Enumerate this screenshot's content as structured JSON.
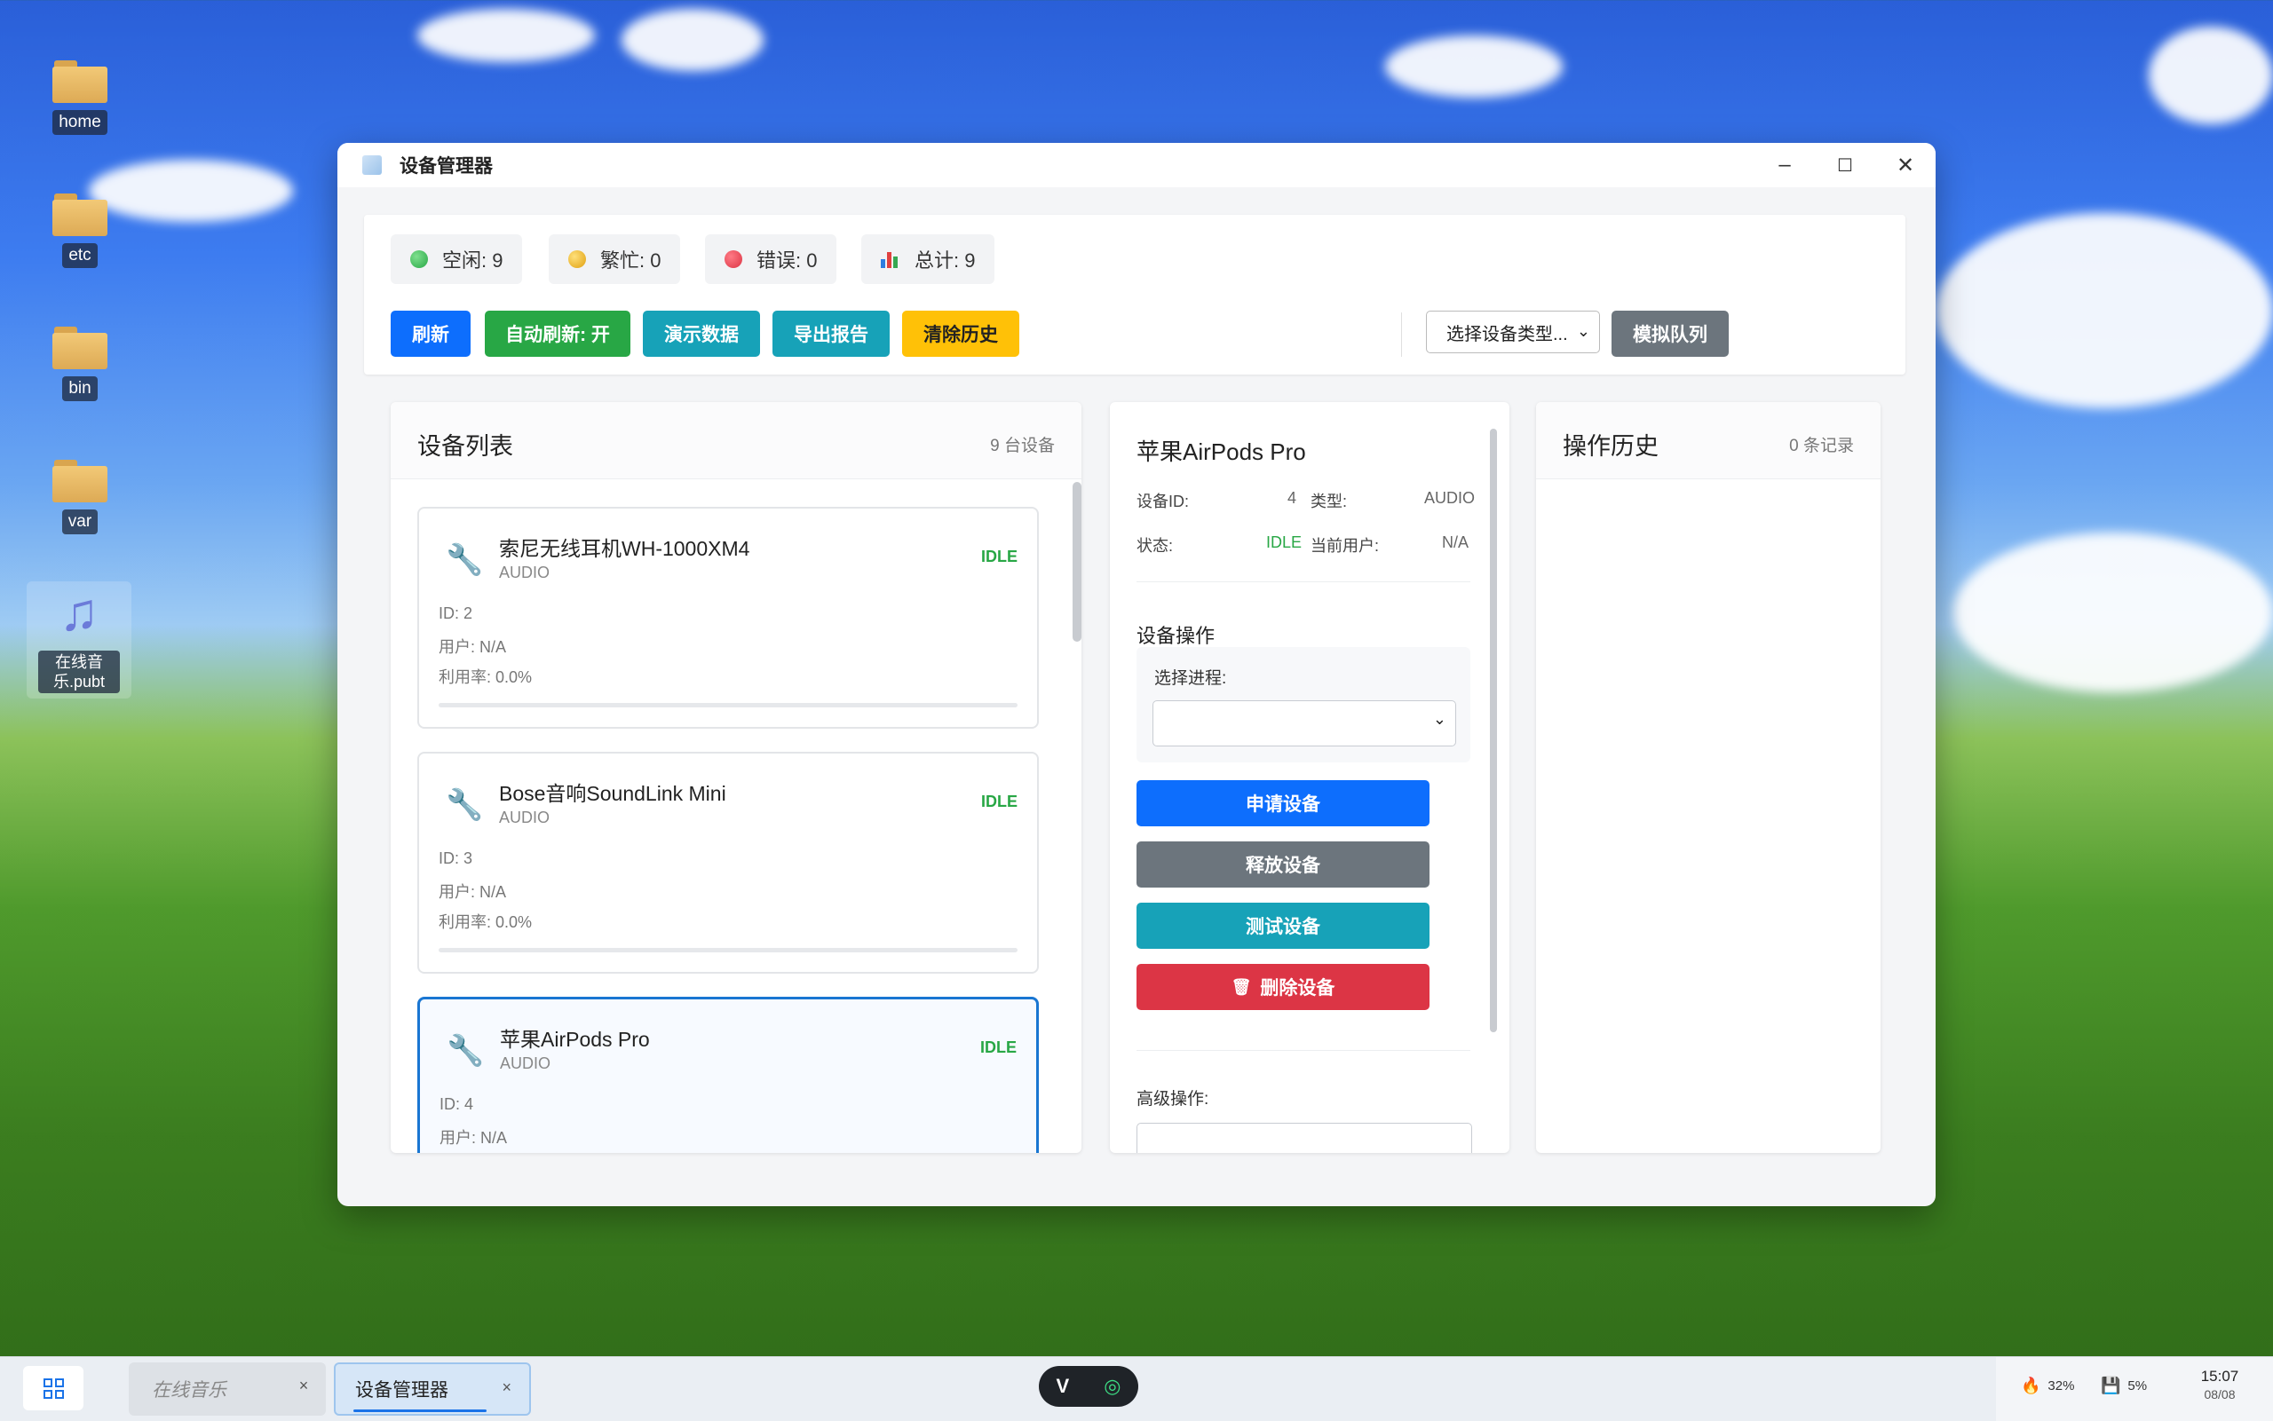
{
  "desktop": {
    "icons": [
      {
        "label": "home",
        "type": "folder"
      },
      {
        "label": "etc",
        "type": "folder"
      },
      {
        "label": "bin",
        "type": "folder"
      },
      {
        "label": "var",
        "type": "folder"
      },
      {
        "label": "在线音乐.pubt",
        "type": "music-file-icon"
      }
    ]
  },
  "window": {
    "title": "设备管理器",
    "controls": {
      "minimize": "–",
      "maximize": "☐",
      "close": "✕"
    }
  },
  "stats": {
    "idle": "空闲: 9",
    "busy": "繁忙: 0",
    "error": "错误: 0",
    "total": "总计: 9"
  },
  "colors": {
    "idle_dot": "#28a745",
    "busy_dot": "#f0b020",
    "error_dot": "#dc3545",
    "primary": "#0d6efd",
    "success": "#28a745",
    "info": "#17a2b8",
    "warning": "#ffc107",
    "secondary": "#6c757d",
    "danger": "#dc3545"
  },
  "toolbar": {
    "refresh": "刷新",
    "auto_refresh": "自动刷新: 开",
    "demo_data": "演示数据",
    "export_report": "导出报告",
    "clear_history": "清除历史",
    "device_type_select": "选择设备类型...",
    "simulate_queue": "模拟队列"
  },
  "device_list": {
    "title": "设备列表",
    "count": "9 台设备",
    "items": [
      {
        "name": "索尼无线耳机WH-1000XM4",
        "type": "AUDIO",
        "status": "IDLE",
        "id": "ID: 2",
        "user": "用户: N/A",
        "util": "利用率: 0.0%",
        "util_value": 0.0
      },
      {
        "name": "Bose音响SoundLink Mini",
        "type": "AUDIO",
        "status": "IDLE",
        "id": "ID: 3",
        "user": "用户: N/A",
        "util": "利用率: 0.0%",
        "util_value": 0.0
      },
      {
        "name": "苹果AirPods Pro",
        "type": "AUDIO",
        "status": "IDLE",
        "id": "ID: 4",
        "user": "用户: N/A",
        "util": "利用率: 0.0%",
        "util_value": 0.0
      }
    ]
  },
  "detail": {
    "name": "苹果AirPods Pro",
    "id_label": "设备ID:",
    "id_value": "4",
    "type_label": "类型:",
    "type_value": "AUDIO",
    "status_label": "状态:",
    "status_value": "IDLE",
    "user_label": "当前用户:",
    "user_value": "N/A",
    "ops_title": "设备操作",
    "process_label": "选择进程:",
    "process_value": "",
    "request": "申请设备",
    "release": "释放设备",
    "test": "测试设备",
    "delete": "删除设备",
    "advanced": "高级操作:"
  },
  "history": {
    "title": "操作历史",
    "count": "0 条记录"
  },
  "taskbar": {
    "tasks": [
      {
        "label": "在线音乐",
        "active": false
      },
      {
        "label": "设备管理器",
        "active": true
      }
    ],
    "tray": {
      "cpu": "32%",
      "mem": "5%",
      "time": "15:07",
      "date": "08/08"
    }
  }
}
